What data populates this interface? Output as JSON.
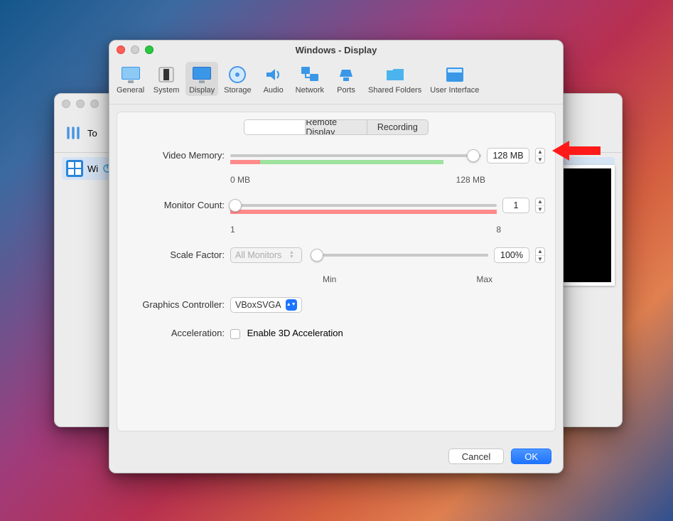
{
  "window_title": "Windows - Display",
  "toolbar": {
    "items": [
      {
        "id": "general",
        "label": "General"
      },
      {
        "id": "system",
        "label": "System"
      },
      {
        "id": "display",
        "label": "Display"
      },
      {
        "id": "storage",
        "label": "Storage"
      },
      {
        "id": "audio",
        "label": "Audio"
      },
      {
        "id": "network",
        "label": "Network"
      },
      {
        "id": "ports",
        "label": "Ports"
      },
      {
        "id": "shared",
        "label": "Shared Folders"
      },
      {
        "id": "ui",
        "label": "User Interface"
      }
    ],
    "selected": "display"
  },
  "tabs": {
    "screen": "",
    "remote": "Remote Display",
    "recording": "Recording",
    "active": "screen"
  },
  "rows": {
    "video_memory": {
      "label": "Video Memory:",
      "value": "128 MB",
      "min_label": "0 MB",
      "max_label": "128 MB",
      "thumb_pct": 97
    },
    "monitor_count": {
      "label": "Monitor Count:",
      "value": "1",
      "min_label": "1",
      "max_label": "8",
      "thumb_pct": 0
    },
    "scale_factor": {
      "label": "Scale Factor:",
      "scope": "All Monitors",
      "value": "100%",
      "min_label": "Min",
      "max_label": "Max",
      "thumb_pct": 0
    },
    "graphics_controller": {
      "label": "Graphics Controller:",
      "value": "VBoxSVGA"
    },
    "acceleration": {
      "label": "Acceleration:",
      "checkbox_label": "Enable 3D Acceleration",
      "checked": false
    }
  },
  "footer": {
    "cancel": "Cancel",
    "ok": "OK"
  },
  "background_window": {
    "tools_label": "To",
    "vm_label": "Wi"
  }
}
